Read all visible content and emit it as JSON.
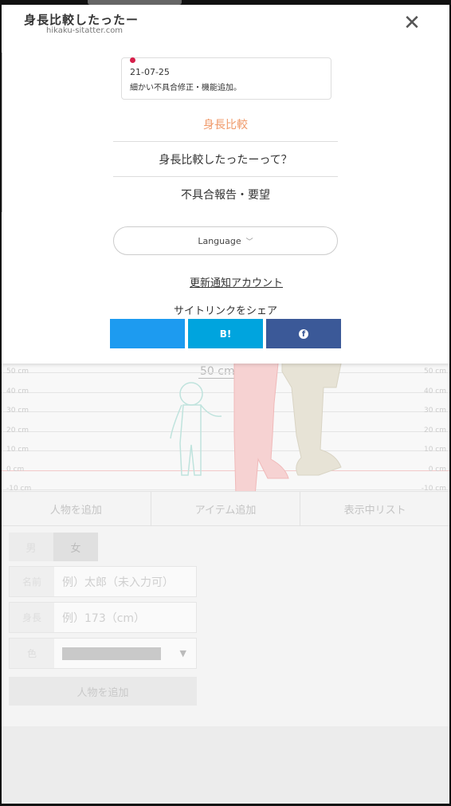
{
  "header": {
    "title": "身長比較したったー",
    "url": "hikaku-sitatter.com",
    "close_icon": "close-icon"
  },
  "news": {
    "date": "21-07-25",
    "text": "細かい不具合修正・機能追加。"
  },
  "nav": {
    "items": [
      {
        "label": "身長比較"
      },
      {
        "label": "身長比較したったーって？"
      },
      {
        "label": "不具合報告・要望"
      }
    ]
  },
  "language": {
    "label": "Language",
    "chevron": "chevron-down-icon"
  },
  "update_account": "更新通知アカウント",
  "share": {
    "label": "サイトリンクをシェア",
    "buttons": [
      {
        "name": "twitter",
        "text": ""
      },
      {
        "name": "hatena",
        "text": "B!"
      },
      {
        "name": "facebook",
        "text": "f"
      }
    ]
  },
  "chart": {
    "measure": "50 cm",
    "grid_labels": [
      "50 cm",
      "40 cm",
      "30 cm",
      "20 cm",
      "10 cm",
      "0 cm",
      "-10 cm"
    ]
  },
  "tabs": [
    {
      "label": "人物を追加"
    },
    {
      "label": "アイテム追加"
    },
    {
      "label": "表示中リスト"
    }
  ],
  "form": {
    "gender": {
      "male": "男",
      "female": "女"
    },
    "name": {
      "label": "名前",
      "placeholder": "例）太郎（未入力可）"
    },
    "height": {
      "label": "身長",
      "placeholder": "例）173（cm）"
    },
    "color": {
      "label": "色"
    },
    "add_button": "人物を追加"
  },
  "colors": {
    "accent": "#f09a6a",
    "twitter": "#1d9bf0",
    "hatena": "#00a4de",
    "facebook": "#3b5998",
    "news_dot": "#d61f4a"
  }
}
